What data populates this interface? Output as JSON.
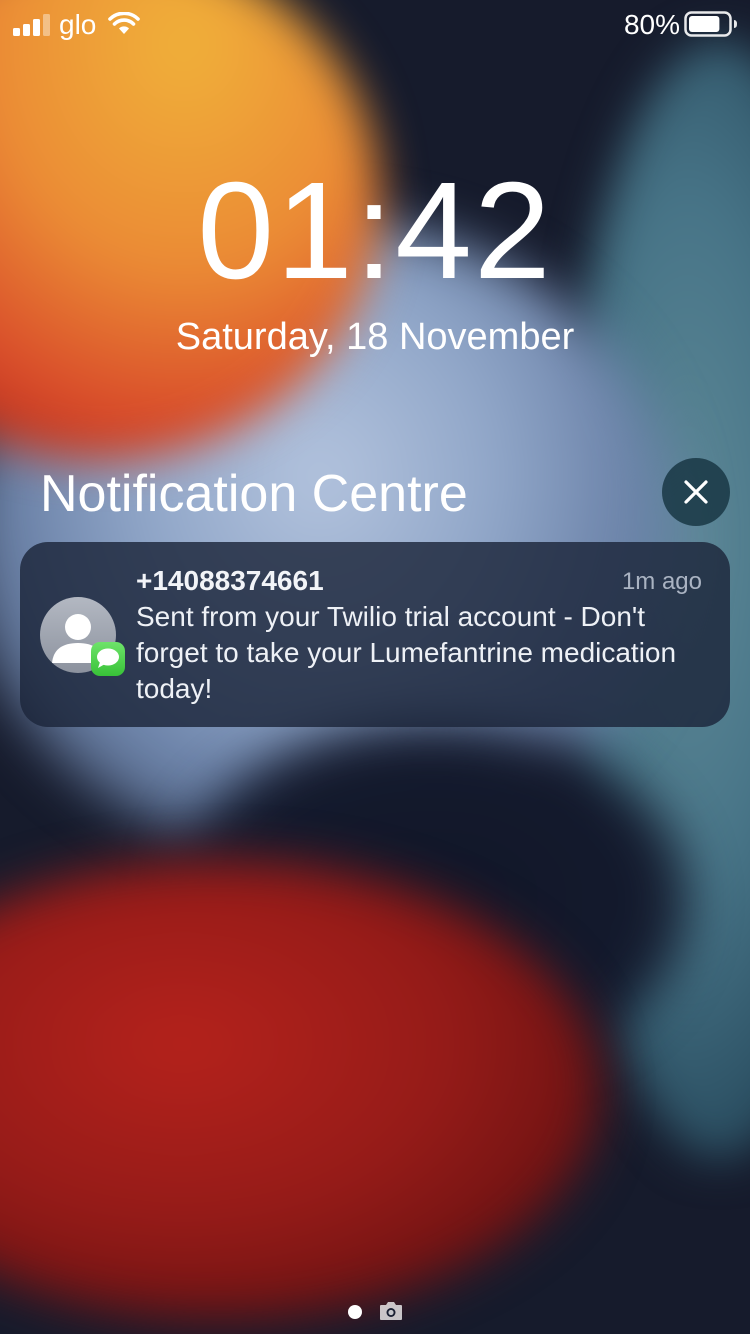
{
  "status_bar": {
    "carrier": "glo",
    "battery_percent": "80%",
    "battery_level": 0.8,
    "signal_icon": "cellular-signal-icon",
    "wifi_icon": "wifi-icon",
    "battery_icon": "battery-icon"
  },
  "lock_screen": {
    "time": "01:42",
    "date": "Saturday, 18 November"
  },
  "notification_centre": {
    "title": "Notification Centre",
    "clear_icon": "close-icon",
    "notifications": [
      {
        "sender": "+14088374661",
        "time_ago": "1m ago",
        "message": "Sent from your Twilio trial account - Don't forget to take your Lumefantrine medication today!",
        "avatar_icon": "contact-avatar-icon",
        "app_icon": "messages-app-icon",
        "app_color": "#4cd24c"
      }
    ]
  },
  "page_indicator": {
    "camera_icon": "camera-icon"
  }
}
